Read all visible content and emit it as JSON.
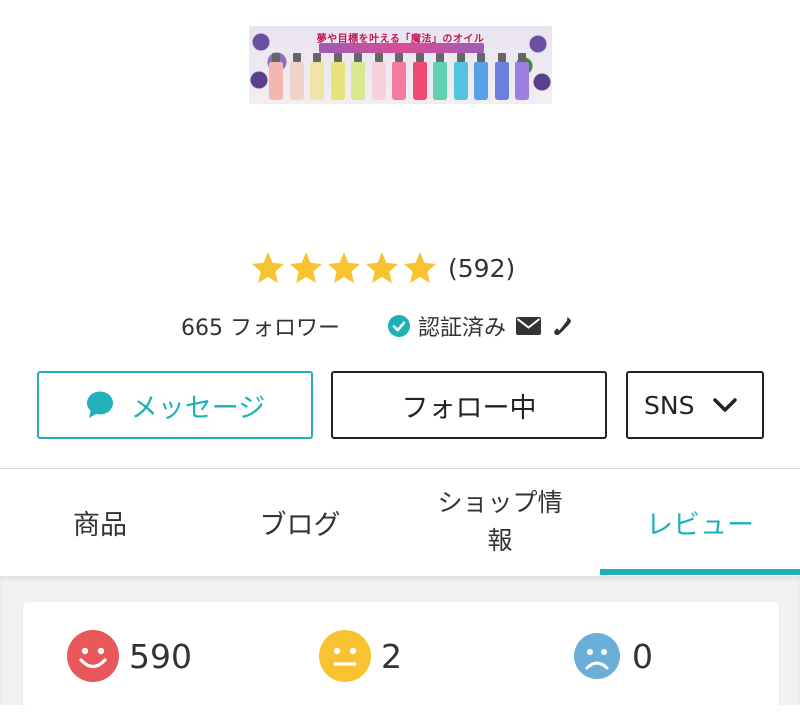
{
  "banner": {
    "caption": "夢や目標を叶える「魔法」のオイル",
    "bottle_colors": [
      "#f4b6b0",
      "#f2d3c9",
      "#efe3a8",
      "#e8e27a",
      "#d9e88c",
      "#f6d1da",
      "#f57aa0",
      "#ef4a72",
      "#5fd0b0",
      "#53c3e0",
      "#5aa0e8",
      "#6b7fe0",
      "#9a7fe0"
    ]
  },
  "rating": {
    "stars": 5,
    "count_text": "(592)",
    "star_color": "#f7c331"
  },
  "shop_meta": {
    "followers_text": "665 フォロワー",
    "verified_text": "認証済み"
  },
  "buttons": {
    "message": "メッセージ",
    "follow": "フォロー中",
    "sns": "SNS"
  },
  "tabs": [
    {
      "label": "商品",
      "active": false
    },
    {
      "label": "ブログ",
      "active": false
    },
    {
      "label": "ショップ情報",
      "line1": "ショップ情",
      "line2": "報",
      "active": false
    },
    {
      "label": "レビュー",
      "active": true
    }
  ],
  "review_summary": {
    "good": "590",
    "neutral": "2",
    "bad": "0"
  },
  "colors": {
    "accent": "#1fb0b8",
    "good_face": "#e8585a",
    "neutral_face": "#f7c331",
    "bad_face": "#6aafd8"
  },
  "icons": {
    "verified": "check-circle-icon",
    "mail": "mail-icon",
    "phone": "phone-icon",
    "message": "speech-bubble-icon",
    "sns_dropdown": "chevron-down-icon",
    "good": "smile-face-icon",
    "neutral": "neutral-face-icon",
    "bad": "sad-face-icon"
  }
}
